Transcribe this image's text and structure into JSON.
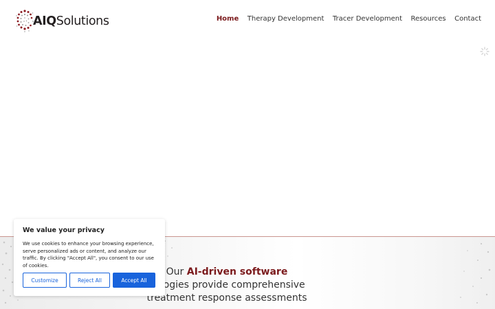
{
  "logo": {
    "prefix": "AIQ",
    "suffix": "Solutions",
    "icon": "dotted-circle-logo-icon"
  },
  "nav": {
    "items": [
      {
        "label": "Home",
        "active": true
      },
      {
        "label": "Therapy Development",
        "active": false
      },
      {
        "label": "Tracer Development",
        "active": false
      },
      {
        "label": "Resources",
        "active": false
      },
      {
        "label": "Contact",
        "active": false
      }
    ]
  },
  "hero": {
    "line1_pre": "Our ",
    "line1_highlight": "AI-driven software",
    "line2": "nologies provide comprehensive",
    "line3": "treatment response assessments"
  },
  "cookie_banner": {
    "title": "We value your privacy",
    "body": "We use cookies to enhance your browsing experience, serve personalized ads or content, and analyze our traffic. By clicking \"Accept All\", you consent to our use of cookies.",
    "customize_label": "Customize",
    "reject_label": "Reject All",
    "accept_label": "Accept All"
  },
  "colors": {
    "brand": "#7b1a1c",
    "accent_blue": "#1863dc",
    "divider": "#c9958f"
  }
}
